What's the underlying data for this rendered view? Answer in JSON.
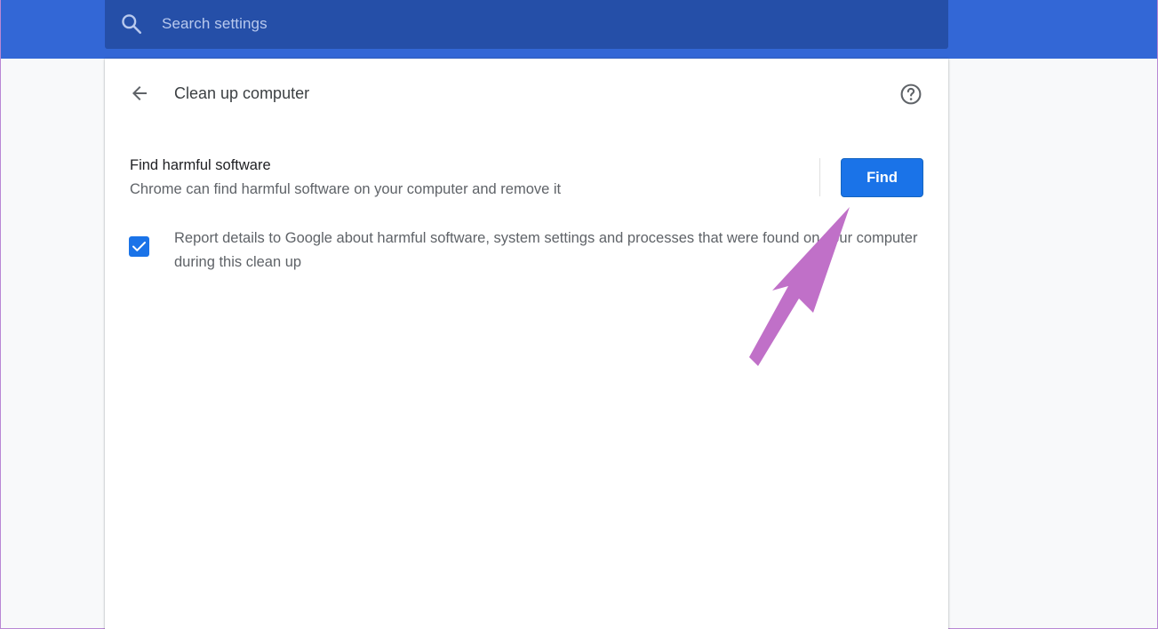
{
  "header": {
    "search_placeholder": "Search settings",
    "search_icon": "search-icon"
  },
  "page": {
    "title": "Clean up computer",
    "back_icon": "arrow-back-icon",
    "help_icon": "help-circle-icon"
  },
  "find_section": {
    "title": "Find harmful software",
    "description": "Chrome can find harmful software on your computer and remove it",
    "button_label": "Find"
  },
  "report": {
    "checked": true,
    "label": "Report details to Google about harmful software, system settings and processes that were found on your computer during this clean up"
  },
  "annotation": {
    "icon": "pointer-arrow-icon",
    "color": "#c070c8"
  },
  "colors": {
    "header_bg": "#3367d6",
    "search_bg": "#254fa8",
    "accent": "#1a73e8",
    "page_bg": "#f8f9fa"
  }
}
